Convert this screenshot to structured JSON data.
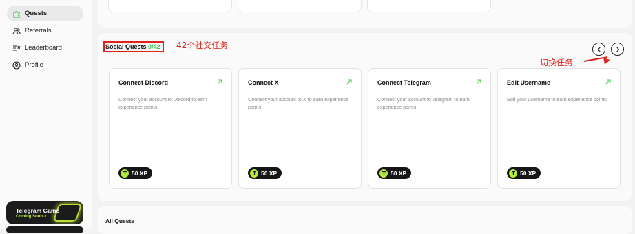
{
  "sidebar": {
    "items": [
      {
        "label": "Quests",
        "icon": "puzzle-icon",
        "active": true
      },
      {
        "label": "Referrals",
        "icon": "users-icon",
        "active": false
      },
      {
        "label": "Leaderboard",
        "icon": "leaderboard-icon",
        "active": false
      },
      {
        "label": "Profile",
        "icon": "user-circle-icon",
        "active": false
      }
    ],
    "telegram_card": {
      "title": "Telegram Game",
      "subtitle": "Coming Soon >"
    }
  },
  "social": {
    "title": "Social Quests",
    "count": "0/42",
    "annotation_count": "42个社交任务",
    "annotation_switch": "切换任务",
    "cards": [
      {
        "title": "Connect Discord",
        "desc": "Connect your account to Discord to earn experience points",
        "xp": "50 XP"
      },
      {
        "title": "Connect X",
        "desc": "Connect your account to X to earn experience points",
        "xp": "50 XP"
      },
      {
        "title": "Connect Telegram",
        "desc": "Connect your account to Telegram to earn experience points",
        "xp": "50 XP"
      },
      {
        "title": "Edit Username",
        "desc": "Edit your username to earn experience points",
        "xp": "50 XP"
      }
    ]
  },
  "all_quests": {
    "title": "All Quests"
  },
  "colors": {
    "accent_green": "#2cc84a",
    "lime": "#b5ec3a",
    "annotation_red": "#e1221a",
    "dark": "#161616"
  }
}
